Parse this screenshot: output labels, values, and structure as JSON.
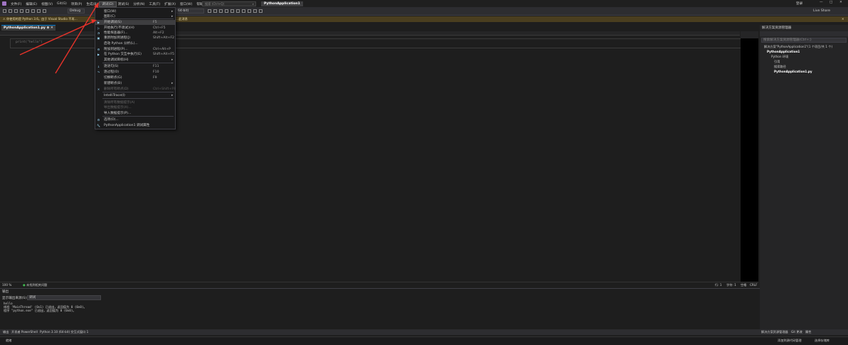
{
  "titlebar": {
    "menu": [
      "文件(F)",
      "编辑(E)",
      "视图(V)",
      "Git(G)",
      "项目(P)",
      "生成(B)",
      "调试(D)",
      "测试(S)",
      "分析(N)",
      "工具(T)",
      "扩展(X)",
      "窗口(W)",
      "帮助(H)"
    ],
    "search_placeholder": "搜索 (Ctrl+Q)",
    "app_title": "PythonApplication1",
    "signin": "登录",
    "live_share": "Live Share"
  },
  "toolbar": {
    "config": "Debug",
    "platform": "64-bit)"
  },
  "infobar": {
    "text": "你使用的是 Python 3.6。由于 Visual Studio 不再…",
    "text_right": "…此消息"
  },
  "editor": {
    "tab_label": "PythonApplication1.py",
    "code": "print(\"hello\")",
    "zoom": "100 %",
    "status_issues": "未找到相关问题",
    "line": "行: 1",
    "char": "字符: 1",
    "spaces": "空格",
    "eol": "CRLF"
  },
  "debug_menu": {
    "items": [
      {
        "label": "窗口(W)",
        "shortcut": "",
        "arrow": "▸",
        "icon": ""
      },
      {
        "label": "图形(C)",
        "shortcut": "",
        "arrow": "▸",
        "icon": ""
      },
      {
        "label": "开始调试(S)",
        "shortcut": "F5",
        "arrow": "",
        "icon": "▶"
      },
      {
        "label": "开始执行(不调试)(H)",
        "shortcut": "Ctrl+F5",
        "arrow": "",
        "icon": "▷"
      },
      {
        "label": "性能探查器(F)...",
        "shortcut": "Alt+F2",
        "arrow": "",
        "icon": "◔"
      },
      {
        "label": "重新附加到进程(J)",
        "shortcut": "Shift+Alt+F2",
        "arrow": "",
        "icon": "▣"
      },
      {
        "label": "启动 Python 分析(L)...",
        "shortcut": "",
        "arrow": "",
        "icon": ""
      },
      {
        "label": "附加到进程(P)...",
        "shortcut": "Ctrl+Alt+P",
        "arrow": "",
        "icon": "⚙"
      },
      {
        "label": "在 Python 交互中执行(E)",
        "shortcut": "Shift+Alt+F5",
        "arrow": "",
        "icon": "▶"
      },
      {
        "label": "其他调试目标(H)",
        "shortcut": "",
        "arrow": "▸",
        "icon": ""
      },
      {
        "label": "逐语句(S)",
        "shortcut": "F11",
        "arrow": "",
        "icon": "↓"
      },
      {
        "label": "逐过程(O)",
        "shortcut": "F10",
        "arrow": "",
        "icon": "↷"
      },
      {
        "label": "切换断点(G)",
        "shortcut": "F9",
        "arrow": "",
        "icon": ""
      },
      {
        "label": "新建断点(B)",
        "shortcut": "",
        "arrow": "▸",
        "icon": ""
      },
      {
        "label": "删除所有断点(D)",
        "shortcut": "Ctrl+Shift+F9",
        "arrow": "",
        "icon": "✕"
      },
      {
        "label": "IntelliTrace(I)",
        "shortcut": "",
        "arrow": "▸",
        "icon": ""
      },
      {
        "label": "清除所有数据提示(A)",
        "shortcut": "",
        "arrow": "",
        "icon": ""
      },
      {
        "label": "导出数据提示(X)...",
        "shortcut": "",
        "arrow": "",
        "icon": ""
      },
      {
        "label": "导入数据提示(P)...",
        "shortcut": "",
        "arrow": "",
        "icon": ""
      },
      {
        "label": "选项(O)...",
        "shortcut": "",
        "arrow": "",
        "icon": "⚙"
      },
      {
        "label": "PythonApplication1 调试属性",
        "shortcut": "",
        "arrow": "",
        "icon": "🔧"
      }
    ]
  },
  "solution_explorer": {
    "title": "解决方案资源管理器",
    "search_placeholder": "搜索解决方案资源管理器(Ctrl+;)",
    "solution": "解决方案\"PythonApplication1\"(1 个项目/共 1 个)",
    "project": "PythonApplication1",
    "env": "Python 环境",
    "refs": "引用",
    "search_paths": "搜索路径",
    "file": "PythonApplication1.py",
    "tab1": "解决方案资源管理器",
    "tab2": "Git 更改",
    "tab3": "属性"
  },
  "output": {
    "title": "输出",
    "show_from_label": "显示输出来源(S):",
    "show_from_value": "调试",
    "lines": [
      "hello",
      "线程 'MainThread' (0x1) 已退出，返回值为 0 (0x0)。",
      "程序 \"python.exe\" 已退出，返回值为 0 (0x0)。"
    ]
  },
  "bottom_tabs": [
    "输出",
    "开发者 PowerShell",
    "Python 3.10 (64-bit) 交互式窗口 1"
  ],
  "statusbar": {
    "ready": "就绪",
    "add_source": "添加到源代码管理",
    "select_repo": "选择存储库"
  },
  "colors": {
    "accent": "#007acc",
    "arrow": "#e8332a",
    "menu_bg": "#1b1b1c",
    "infobar": "#4a3e1f"
  }
}
